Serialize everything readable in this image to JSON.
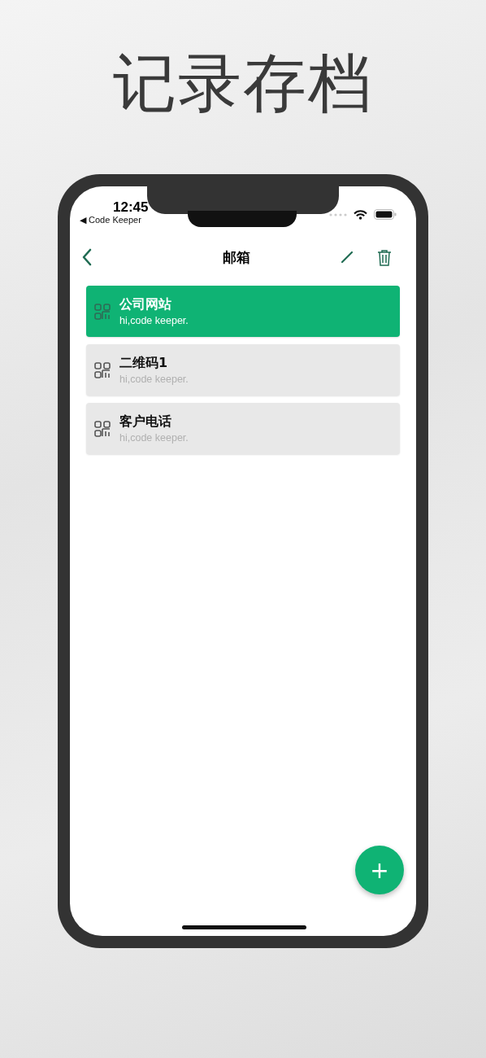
{
  "headline": "记录存档",
  "status_bar": {
    "time": "12:45",
    "back_app": "◀ Code Keeper"
  },
  "nav": {
    "title": "邮箱"
  },
  "items": [
    {
      "title": "公司网站",
      "subtitle": "hi,code keeper.",
      "selected": true
    },
    {
      "title": "二维码1",
      "subtitle": "hi,code keeper.",
      "selected": false
    },
    {
      "title": "客户电话",
      "subtitle": "hi,code keeper.",
      "selected": false
    }
  ],
  "fab": {
    "label": "+"
  }
}
